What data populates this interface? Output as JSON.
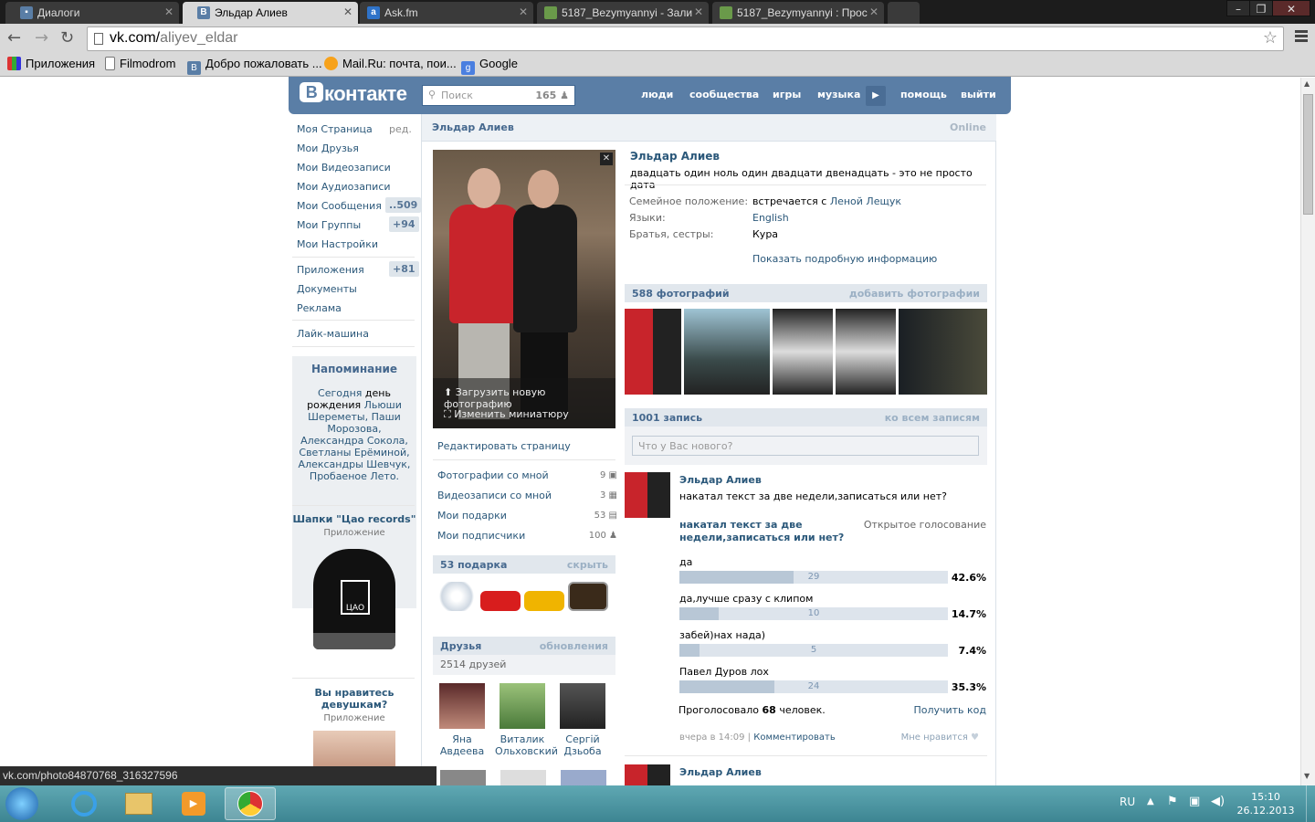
{
  "browser": {
    "tabs": [
      {
        "label": "Диалоги",
        "icon": "chat-icon",
        "color": "#5a7ea6"
      },
      {
        "label": "Эльдар Алиев",
        "icon": "vk-icon",
        "color": "#5a7ea6",
        "active": true
      },
      {
        "label": "Ask.fm",
        "icon": "askfm-icon",
        "color": "#2f73c9"
      },
      {
        "label": "5187_Bezymyannyi - Зали",
        "icon": "image-icon",
        "color": "#6a9a4a"
      },
      {
        "label": "5187_Bezymyannyi : Прос",
        "icon": "image-icon",
        "color": "#6a9a4a"
      }
    ],
    "url_host": "vk.com/",
    "url_path": "aliyev_eldar",
    "bookmarks": [
      "Приложения",
      "Filmodrom",
      "Добро пожаловать ...",
      "Mail.Ru: почта, пои...",
      "Google"
    ],
    "status_url": "vk.com/photo84870768_316327596"
  },
  "vk": {
    "logo": "контакте",
    "logo_letter": "B",
    "search_placeholder": "Поиск",
    "search_count": "165",
    "nav": [
      "люди",
      "сообщества",
      "игры",
      "музыка",
      "помощь",
      "выйти"
    ]
  },
  "leftmenu": {
    "items": [
      {
        "label": "Моя Страница",
        "extra": "ред."
      },
      {
        "label": "Мои Друзья"
      },
      {
        "label": "Мои Видеозаписи"
      },
      {
        "label": "Мои Аудиозаписи"
      },
      {
        "label": "Мои Сообщения",
        "badge": "..509"
      },
      {
        "label": "Мои Группы",
        "badge": "+94"
      },
      {
        "label": "Мои Настройки"
      },
      {
        "label": "Приложения",
        "badge": "+81"
      },
      {
        "label": "Документы"
      },
      {
        "label": "Реклама"
      },
      {
        "label": "Лайк-машина"
      }
    ],
    "reminder": {
      "title": "Напоминание",
      "today": "Сегодня",
      "text1": "день рождения",
      "names": "Льюши Шереметы, Паши Морозова, Александра Сокола, Светланы Ерёминой, Александры Шевчук, Пробаеное Лето."
    },
    "app1": {
      "title": "Шапки \"Цао records\"",
      "sub": "Приложение",
      "logo": "ЦАО"
    },
    "app2": {
      "title": "Вы нравитесь девушкам?",
      "sub": "Приложение"
    }
  },
  "profile": {
    "name": "Эльдар Алиев",
    "online": "Online",
    "status": "двадцать один ноль один двадцати двенадцать - это не просто дата",
    "upload_photo": "Загрузить новую фотографию",
    "change_thumb": "Изменить миниатюру",
    "edit_page": "Редактировать страницу",
    "links": [
      {
        "label": "Фотографии со мной",
        "count": "9"
      },
      {
        "label": "Видеозаписи со мной",
        "count": "3"
      },
      {
        "label": "Мои подарки",
        "count": "53"
      },
      {
        "label": "Мои подписчики",
        "count": "100"
      }
    ],
    "gifts_title": "53 подарка",
    "gifts_hide": "скрыть",
    "friends_title": "Друзья",
    "friends_updates": "обновления",
    "friends_count": "2514 друзей",
    "friends": [
      {
        "first": "Яна",
        "last": "Авдеева"
      },
      {
        "first": "Виталик",
        "last": "Ольховский"
      },
      {
        "first": "Сергій",
        "last": "Дзьоба"
      }
    ],
    "info": [
      {
        "label": "Семейное положение:",
        "value": "встречается с",
        "link": "Леной Лещук"
      },
      {
        "label": "Языки:",
        "value": "",
        "link": "English"
      },
      {
        "label": "Братья, сестры:",
        "value": "Кура",
        "link": ""
      }
    ],
    "show_more": "Показать подробную информацию",
    "photos_title": "588 фотографий",
    "photos_add": "добавить фотографии",
    "wall_title": "1001 запись",
    "wall_all": "ко всем записям",
    "wall_placeholder": "Что у Вас нового?"
  },
  "post": {
    "author": "Эльдар Алиев",
    "text": "накатал текст за две недели,записаться или нет?",
    "poll_question": "накатал текст за две недели,записаться или нет?",
    "poll_type": "Открытое голосование",
    "options": [
      {
        "label": "да",
        "votes": "29",
        "pct": "42.6%",
        "frac": 0.426
      },
      {
        "label": "да,лучше сразу с клипом",
        "votes": "10",
        "pct": "14.7%",
        "frac": 0.147
      },
      {
        "label": "забей)нах нада)",
        "votes": "5",
        "pct": "7.4%",
        "frac": 0.074
      },
      {
        "label": "Павел Дуров лох",
        "votes": "24",
        "pct": "35.3%",
        "frac": 0.353
      }
    ],
    "voted_prefix": "Проголосовало",
    "voted_count": "68",
    "voted_suffix": "человек.",
    "get_code": "Получить код",
    "time": "вчера в 14:09",
    "comment": "Комментировать",
    "like": "Мне нравится",
    "next_author": "Эльдар Алиев"
  },
  "taskbar": {
    "lang": "RU",
    "time": "15:10",
    "date": "26.12.2013"
  }
}
